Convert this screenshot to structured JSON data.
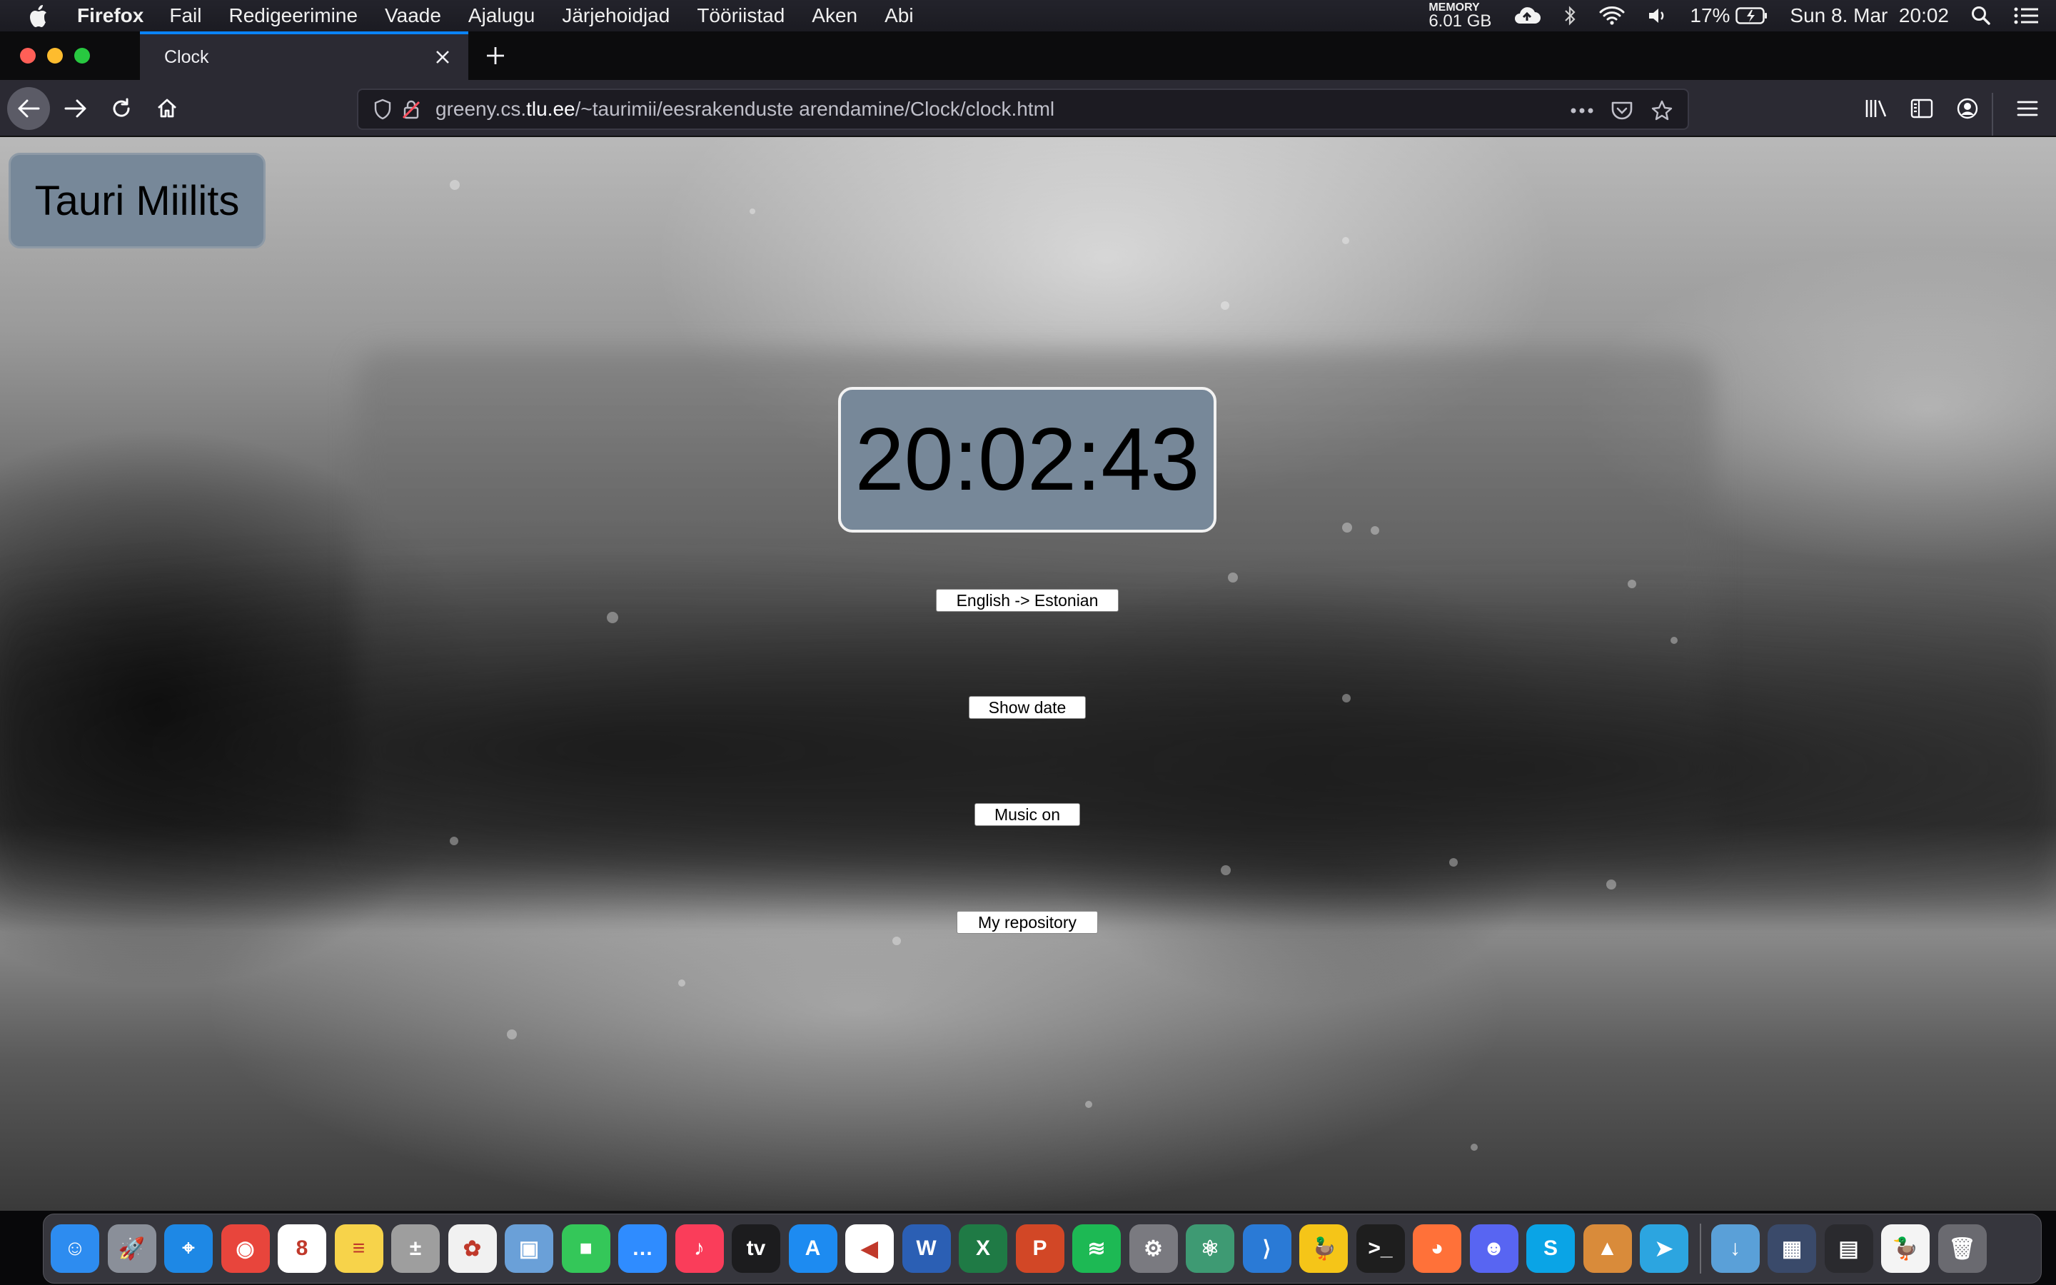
{
  "menubar": {
    "app_name": "Firefox",
    "menus": [
      "Fail",
      "Redigeerimine",
      "Vaade",
      "Ajalugu",
      "Järjehoidjad",
      "Tööriistad",
      "Aken",
      "Abi"
    ],
    "memory_label": "MEMORY",
    "memory_value": "6.01 GB",
    "battery_percent": "17%",
    "datetime": "Sun 8. Mar  20:02",
    "icons": [
      "apple-icon",
      "cloud-upload-icon",
      "bluetooth-icon",
      "wifi-icon",
      "volume-icon",
      "battery-icon",
      "spotlight-search-icon",
      "notification-center-icon"
    ]
  },
  "browser": {
    "tab_title": "Clock",
    "url_host_prefix": "greeny.cs.",
    "url_host_domain": "tlu.ee",
    "url_path": "/~taurimii/eesrakenduste arendamine/Clock/clock.html"
  },
  "page": {
    "author_name": "Tauri Miilits",
    "clock_time": "20:02:43",
    "language_button": "English -> Estonian",
    "date_button": "Show date",
    "music_button": "Music on",
    "repository_button": "My repository"
  },
  "dock": {
    "apps": [
      {
        "name": "finder",
        "color": "#2d8cf0",
        "glyph": "☺"
      },
      {
        "name": "launchpad",
        "color": "#8a8f99",
        "glyph": "🚀"
      },
      {
        "name": "safari",
        "color": "#1e88e5",
        "glyph": "⌖"
      },
      {
        "name": "chrome",
        "color": "#e8453c",
        "glyph": "◉"
      },
      {
        "name": "calendar",
        "color": "#ffffff",
        "glyph": "8"
      },
      {
        "name": "notes",
        "color": "#f7d34a",
        "glyph": "≡"
      },
      {
        "name": "calculator",
        "color": "#9e9e9e",
        "glyph": "±"
      },
      {
        "name": "photos",
        "color": "#f1f1f1",
        "glyph": "✿"
      },
      {
        "name": "preview",
        "color": "#6aa0d8",
        "glyph": "▣"
      },
      {
        "name": "facetime",
        "color": "#34c759",
        "glyph": "■"
      },
      {
        "name": "messages",
        "color": "#2f8cff",
        "glyph": "…"
      },
      {
        "name": "music",
        "color": "#fa3d5a",
        "glyph": "♪"
      },
      {
        "name": "apple-tv",
        "color": "#1c1c1e",
        "glyph": "tv"
      },
      {
        "name": "app-store",
        "color": "#1d8bf1",
        "glyph": "A"
      },
      {
        "name": "cubase",
        "color": "#ffffff",
        "glyph": "◀"
      },
      {
        "name": "word",
        "color": "#2b5fb4",
        "glyph": "W"
      },
      {
        "name": "excel",
        "color": "#1f7a45",
        "glyph": "X"
      },
      {
        "name": "powerpoint",
        "color": "#d24726",
        "glyph": "P"
      },
      {
        "name": "spotify",
        "color": "#1db954",
        "glyph": "≋"
      },
      {
        "name": "system-preferences",
        "color": "#7a7a80",
        "glyph": "⚙"
      },
      {
        "name": "atom",
        "color": "#3e9a73",
        "glyph": "⚛"
      },
      {
        "name": "vscode",
        "color": "#2a7ad6",
        "glyph": "⟩"
      },
      {
        "name": "cyberduck",
        "color": "#f5c518",
        "glyph": "🦆"
      },
      {
        "name": "terminal",
        "color": "#1e1e1e",
        "glyph": ">_"
      },
      {
        "name": "firefox",
        "color": "#ff7139",
        "glyph": "◕"
      },
      {
        "name": "discord",
        "color": "#5865f2",
        "glyph": "☻"
      },
      {
        "name": "skype",
        "color": "#0aa4e6",
        "glyph": "S"
      },
      {
        "name": "mountain-app",
        "color": "#d98b3a",
        "glyph": "▲"
      },
      {
        "name": "telegram",
        "color": "#2ca5e0",
        "glyph": "➤"
      }
    ],
    "stacks": [
      {
        "name": "downloads-folder",
        "color": "#5aa0d8",
        "glyph": "↓"
      },
      {
        "name": "screenshot-1",
        "color": "#3a4a6a",
        "glyph": "▦"
      },
      {
        "name": "screenshot-2",
        "color": "#2a2a2e",
        "glyph": "▤"
      },
      {
        "name": "document-file",
        "color": "#f4f4f4",
        "glyph": "🦆"
      },
      {
        "name": "trash",
        "color": "#6a6a70",
        "glyph": "🗑"
      }
    ]
  }
}
